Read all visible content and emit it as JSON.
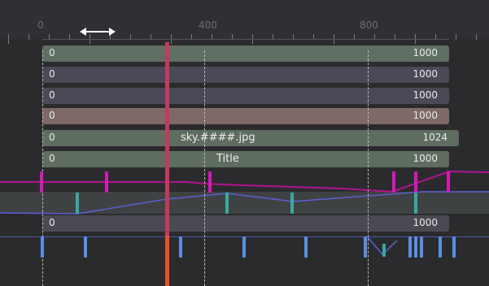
{
  "ruler": {
    "labels": [
      "0",
      "400",
      "800"
    ]
  },
  "tracks": [
    {
      "start": "0",
      "end": "1000",
      "name": "",
      "color": "#5f6e62"
    },
    {
      "start": "0",
      "end": "1000",
      "name": "",
      "color": "#4a4a56"
    },
    {
      "start": "0",
      "end": "1000",
      "name": "",
      "color": "#4a4a56"
    },
    {
      "start": "0",
      "end": "1000",
      "name": "",
      "color": "#7e6966"
    },
    {
      "start": "0",
      "end": "1024",
      "name": "sky.####.jpg",
      "color": "#5e6d60"
    },
    {
      "start": "0",
      "end": "1000",
      "name": "Title",
      "color": "#5e6d60"
    },
    {
      "start": "0",
      "end": "1000",
      "name": "",
      "color": "#4a4a52"
    }
  ],
  "colors": {
    "playhead": "#c23b5e",
    "playhead_bottom": "#e6512b",
    "magenta_key": "#d41ab5",
    "teal_key": "#3aa8a3",
    "blue_key": "#5b8fe0",
    "spline_blue": "#5a5fd8",
    "spline_magenta": "#b0138f"
  },
  "icons": {
    "resize": "double-arrow-horizontal-icon"
  }
}
